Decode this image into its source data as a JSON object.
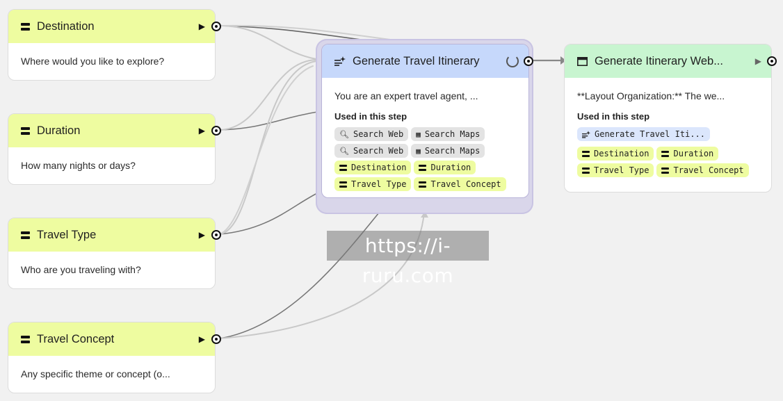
{
  "inputs": [
    {
      "title": "Destination",
      "prompt": "Where would you like to explore?"
    },
    {
      "title": "Duration",
      "prompt": "How many nights or days?"
    },
    {
      "title": "Travel Type",
      "prompt": "Who are you traveling with?"
    },
    {
      "title": "Travel Concept",
      "prompt": "Any specific theme or concept (o..."
    }
  ],
  "generate_step": {
    "title": "Generate Travel Itinerary",
    "description": "You are an expert travel agent, ...",
    "used_label": "Used in this step",
    "tools": [
      "Search Web",
      "Search Maps",
      "Search Web",
      "Search Maps"
    ],
    "inputs": [
      "Destination",
      "Duration",
      "Travel Type",
      "Travel Concept"
    ]
  },
  "output_step": {
    "title": "Generate Itinerary Web...",
    "description": "**Layout Organization:** The we...",
    "used_label": "Used in this step",
    "step_ref": "Generate Travel Iti...",
    "inputs": [
      "Destination",
      "Duration",
      "Travel Type",
      "Travel Concept"
    ]
  },
  "watermark": "https://i-ruru.com",
  "colors": {
    "input_header": "#eefca0",
    "generate_header": "#c6d8fb",
    "output_header": "#c8f5d0",
    "canvas": "#f1f1f1"
  },
  "icons": {
    "input_node": "input-bars-icon",
    "play": "play-icon",
    "port": "output-port-icon",
    "generate": "sparkle-list-icon",
    "loading": "spinner-icon",
    "web_page": "web-page-icon",
    "search": "search-icon",
    "maps": "map-icon"
  }
}
